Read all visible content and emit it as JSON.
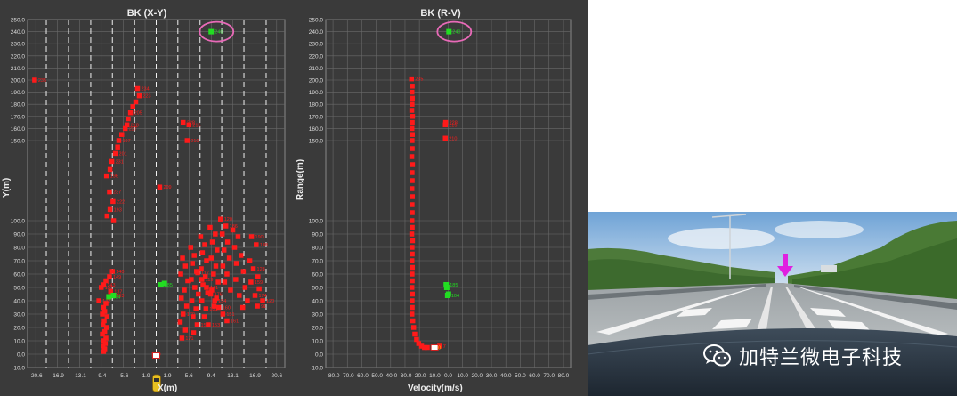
{
  "left_panel": {
    "title": "BK (X-Y)",
    "xlabel": "X(m)",
    "ylabel": "Y(m)"
  },
  "right_panel": {
    "title": "BK (R-V)",
    "xlabel": "Velocity(m/s)",
    "ylabel": "Range(m)"
  },
  "watermark": {
    "text": "加特兰微电子科技",
    "icon": "wechat-icon"
  },
  "colors": {
    "panel_bg": "#3a3a3a",
    "grid": "#6a6a6a",
    "target_static": "#ff1a1a",
    "target_highlight": "#22dd22",
    "circle_marker": "#e86ab8",
    "arrow_marker": "#e020e0"
  },
  "chart_data": [
    {
      "type": "scatter",
      "title": "BK (X-Y)",
      "xlabel": "X(m)",
      "ylabel": "Y(m)",
      "xlim": [
        -22,
        22
      ],
      "ylim": [
        -10,
        250
      ],
      "x_ticks": [
        "-20.6",
        "-16.9",
        "-13.1",
        "-9.4",
        "-5.6",
        "-1.9",
        "1.9",
        "5.6",
        "9.4",
        "13.1",
        "16.9",
        "20.6"
      ],
      "y_ticks": [
        "-10.0",
        "0.0",
        "10.0",
        "20.0",
        "30.0",
        "40.0",
        "50.0",
        "60.0",
        "70.0",
        "80.0",
        "90.0",
        "100.0",
        "150.0",
        "160.0",
        "170.0",
        "180.0",
        "190.0",
        "200.0",
        "210.0",
        "220.0",
        "230.0",
        "240.0",
        "250.0"
      ],
      "lane_lines_x": [
        -18.8,
        -15,
        -11.2,
        -7.5,
        -3.7,
        0,
        3.7,
        7.5,
        11.2,
        15,
        18.8
      ],
      "grid": true,
      "series": [
        {
          "name": "static",
          "color": "#ff1a1a",
          "points": [
            [
              -20.8,
              200,
              "235"
            ],
            [
              -3.2,
              193,
              "234"
            ],
            [
              -2.9,
              187,
              "223"
            ],
            [
              -3.5,
              182
            ],
            [
              -4.0,
              178
            ],
            [
              -4.4,
              173,
              "205"
            ],
            [
              -4.8,
              168
            ],
            [
              -5.0,
              163,
              "218"
            ],
            [
              -5.3,
              160,
              "227"
            ],
            [
              -5.9,
              155
            ],
            [
              -6.4,
              150,
              "197"
            ],
            [
              -6.6,
              146
            ],
            [
              -7.0,
              142,
              "201"
            ],
            [
              -7.6,
              137,
              "231"
            ],
            [
              -7.9,
              132
            ],
            [
              -8.5,
              128,
              "196"
            ],
            [
              -8.0,
              118,
              "237"
            ],
            [
              -7.4,
              112,
              "222"
            ],
            [
              -7.9,
              107,
              "193"
            ],
            [
              -8.4,
              103
            ],
            [
              -7.3,
              100
            ],
            [
              0.6,
              121,
              "209"
            ],
            [
              4.6,
              165,
              "228"
            ],
            [
              5.6,
              163,
              "215"
            ],
            [
              5.3,
              150,
              "210"
            ],
            [
              -7.5,
              62,
              "140"
            ],
            [
              -8.0,
              58,
              "149"
            ],
            [
              -8.6,
              55
            ],
            [
              -9.0,
              52,
              "143"
            ],
            [
              -9.4,
              50,
              "152"
            ],
            [
              -7.8,
              47,
              "137"
            ],
            [
              -7.5,
              44,
              "153"
            ],
            [
              -9.8,
              40,
              "142"
            ],
            [
              -8.6,
              38
            ],
            [
              -9.0,
              35
            ],
            [
              -8.8,
              32
            ],
            [
              -9.2,
              30
            ],
            [
              -8.4,
              28
            ],
            [
              -8.9,
              25
            ],
            [
              -9.1,
              22
            ],
            [
              -8.5,
              20
            ],
            [
              -8.8,
              17
            ],
            [
              -9.2,
              15
            ],
            [
              -8.6,
              12
            ],
            [
              -9.0,
              10
            ],
            [
              -8.7,
              8
            ],
            [
              -9.1,
              6
            ],
            [
              -8.8,
              4
            ],
            [
              -9.0,
              2
            ],
            [
              4.5,
              72
            ],
            [
              5.0,
              66
            ],
            [
              4.2,
              60
            ],
            [
              5.4,
              55
            ],
            [
              4.8,
              48
            ],
            [
              4.3,
              42
            ],
            [
              5.2,
              36
            ],
            [
              4.6,
              30,
              "170"
            ],
            [
              4.1,
              24
            ],
            [
              5.0,
              18
            ],
            [
              4.4,
              12,
              "171"
            ],
            [
              5.9,
              80
            ],
            [
              6.5,
              74
            ],
            [
              6.2,
              68
            ],
            [
              6.9,
              62
            ],
            [
              6.0,
              56
            ],
            [
              6.6,
              50
            ],
            [
              7.2,
              45
            ],
            [
              6.1,
              40
            ],
            [
              6.8,
              34
            ],
            [
              6.3,
              28
            ],
            [
              7.0,
              22,
              "155"
            ],
            [
              6.4,
              16
            ],
            [
              7.6,
              88
            ],
            [
              8.3,
              82
            ],
            [
              7.9,
              76
            ],
            [
              8.6,
              70
            ],
            [
              7.7,
              64
            ],
            [
              8.4,
              58
            ],
            [
              8.0,
              52
            ],
            [
              8.8,
              46
            ],
            [
              7.8,
              40
            ],
            [
              8.5,
              34,
              "181"
            ],
            [
              8.2,
              28
            ],
            [
              8.9,
              22,
              "153"
            ],
            [
              9.2,
              95
            ],
            [
              10.1,
              90
            ],
            [
              9.6,
              84
            ],
            [
              10.4,
              78
            ],
            [
              9.4,
              72
            ],
            [
              10.2,
              66
            ],
            [
              9.8,
              60
            ],
            [
              10.6,
              54
            ],
            [
              9.5,
              48
            ],
            [
              10.3,
              42
            ],
            [
              9.9,
              36
            ],
            [
              11.0,
              101,
              "120"
            ],
            [
              11.9,
              96,
              "186"
            ],
            [
              11.3,
              90
            ],
            [
              12.2,
              84
            ],
            [
              11.6,
              78
            ],
            [
              12.5,
              72
            ],
            [
              11.4,
              66
            ],
            [
              12.1,
              60
            ],
            [
              11.7,
              54
            ],
            [
              12.7,
              48
            ],
            [
              13.1,
              93
            ],
            [
              14.0,
              88
            ],
            [
              13.4,
              80
            ],
            [
              14.5,
              74
            ],
            [
              13.7,
              68
            ],
            [
              14.9,
              62
            ],
            [
              13.6,
              56
            ],
            [
              15.2,
              50
            ],
            [
              14.2,
              44
            ],
            [
              15.6,
              40
            ],
            [
              14.8,
              35
            ],
            [
              16.3,
              88,
              "190"
            ],
            [
              17.1,
              82,
              "188"
            ],
            [
              16.6,
              64,
              "128"
            ],
            [
              17.4,
              58
            ],
            [
              16.2,
              54,
              "159"
            ],
            [
              17.6,
              49
            ],
            [
              16.9,
              44,
              "174"
            ],
            [
              18.2,
              40,
              "120"
            ],
            [
              17.3,
              36,
              "91"
            ],
            [
              16.0,
              70
            ],
            [
              7.1,
              61,
              "117"
            ],
            [
              7.8,
              56,
              "119"
            ],
            [
              8.6,
              50,
              "141"
            ],
            [
              9.3,
              45,
              "176"
            ],
            [
              10.0,
              40,
              "154"
            ],
            [
              10.7,
              35,
              "160"
            ],
            [
              11.4,
              30,
              "151"
            ],
            [
              12.1,
              25,
              "161"
            ],
            [
              -0.3,
              0,
              "0"
            ]
          ]
        },
        {
          "name": "moving",
          "color": "#22dd22",
          "points": [
            [
              9.4,
              240,
              "240"
            ],
            [
              -8.1,
              43,
              "104"
            ],
            [
              -7.3,
              44
            ],
            [
              0.8,
              52,
              "185"
            ],
            [
              1.4,
              53
            ]
          ]
        },
        {
          "name": "ego",
          "color": "#ffffff",
          "points": [
            [
              0,
              -1
            ]
          ]
        }
      ]
    },
    {
      "type": "scatter",
      "title": "BK (R-V)",
      "xlabel": "Velocity(m/s)",
      "ylabel": "Range(m)",
      "xlim": [
        -85,
        85
      ],
      "ylim": [
        -10,
        250
      ],
      "x_ticks": [
        "-80.0",
        "-70.0",
        "-60.0",
        "-50.0",
        "-40.0",
        "-30.0",
        "-20.0",
        "-10.0",
        "0.0",
        "10.0",
        "20.0",
        "30.0",
        "40.0",
        "50.0",
        "60.0",
        "70.0",
        "80.0"
      ],
      "y_ticks": [
        "-10.0",
        "0.0",
        "10.0",
        "20.0",
        "30.0",
        "40.0",
        "50.0",
        "60.0",
        "70.0",
        "80.0",
        "90.0",
        "100.0",
        "150.0",
        "160.0",
        "170.0",
        "180.0",
        "190.0",
        "200.0",
        "210.0",
        "220.0",
        "230.0",
        "240.0",
        "250.0"
      ],
      "grid": true,
      "series": [
        {
          "name": "static",
          "color": "#ff1a1a",
          "points": [
            [
              -25.5,
              201,
              "235"
            ],
            [
              -25.0,
              195
            ],
            [
              -25.2,
              190
            ],
            [
              -24.9,
              185
            ],
            [
              -25.1,
              180
            ],
            [
              -25.3,
              175
            ],
            [
              -24.8,
              170
            ],
            [
              -25.0,
              165
            ],
            [
              -25.2,
              160
            ],
            [
              -24.9,
              155
            ],
            [
              -25.1,
              150
            ],
            [
              -25.0,
              145
            ],
            [
              -25.3,
              140
            ],
            [
              -24.8,
              135
            ],
            [
              -25.1,
              130
            ],
            [
              -25.0,
              125
            ],
            [
              -25.2,
              120
            ],
            [
              -24.9,
              115
            ],
            [
              -25.1,
              110
            ],
            [
              -25.0,
              105
            ],
            [
              -25.2,
              100
            ],
            [
              -25.0,
              95
            ],
            [
              -25.3,
              90
            ],
            [
              -24.8,
              85
            ],
            [
              -25.1,
              80
            ],
            [
              -25.0,
              75
            ],
            [
              -25.2,
              70
            ],
            [
              -24.9,
              65
            ],
            [
              -25.1,
              60
            ],
            [
              -25.0,
              55
            ],
            [
              -25.2,
              50
            ],
            [
              -24.9,
              45
            ],
            [
              -25.1,
              40
            ],
            [
              -25.0,
              35
            ],
            [
              -25.2,
              30
            ],
            [
              -24.6,
              25
            ],
            [
              -24.0,
              20
            ],
            [
              -23.2,
              15
            ],
            [
              -22.0,
              11
            ],
            [
              -20.5,
              8
            ],
            [
              -18.5,
              6
            ],
            [
              -16.5,
              5
            ],
            [
              -14.5,
              5
            ],
            [
              -1.8,
              165,
              "228"
            ],
            [
              -2.0,
              163,
              "215"
            ],
            [
              -2.0,
              152,
              "210"
            ],
            [
              -6.0,
              6,
              "7"
            ]
          ]
        },
        {
          "name": "moving",
          "color": "#22dd22",
          "points": [
            [
              0.5,
              240,
              "240"
            ],
            [
              -1.4,
              52,
              "185"
            ],
            [
              -1.0,
              50
            ],
            [
              -0.4,
              44,
              "104"
            ],
            [
              0.2,
              45
            ]
          ]
        },
        {
          "name": "ego",
          "color": "#ffffff",
          "points": [
            [
              -9.5,
              5,
              "0"
            ]
          ]
        }
      ]
    }
  ]
}
